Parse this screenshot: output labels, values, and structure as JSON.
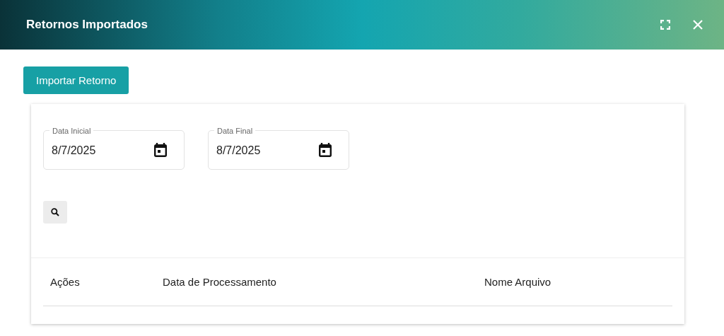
{
  "window": {
    "title": "Retornos Importados"
  },
  "import_button": "Importar Retorno",
  "filters": [
    {
      "label": "Data Inicial",
      "value": "8/7/2025"
    },
    {
      "label": "Data Final",
      "value": "8/7/2025"
    }
  ],
  "table": {
    "columns": [
      "Ações",
      "Data de Processamento",
      "Nome Arquivo"
    ]
  }
}
